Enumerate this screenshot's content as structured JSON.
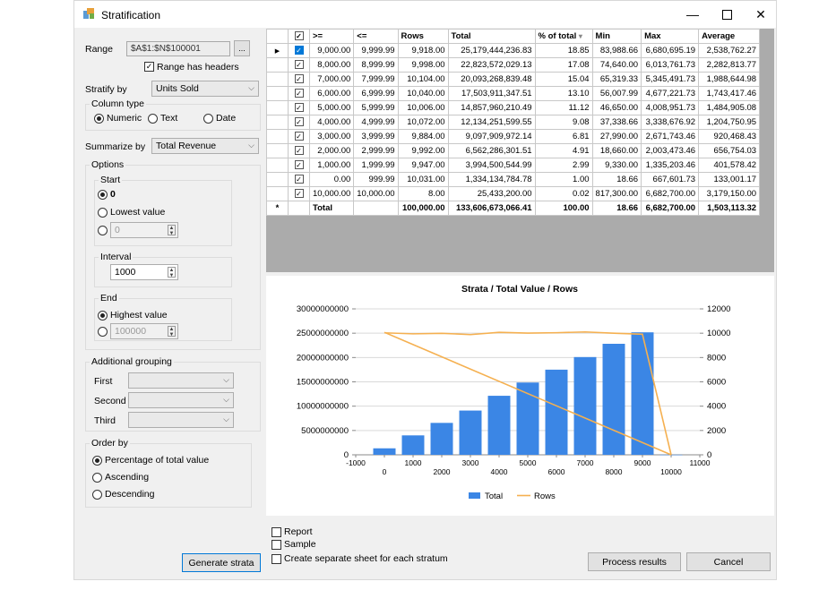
{
  "window": {
    "title": "Stratification"
  },
  "left": {
    "range_label": "Range",
    "range_value": "$A$1:$N$100001",
    "range_btn": "...",
    "has_headers_label": "Range has headers",
    "stratify_label": "Stratify by",
    "stratify_value": "Units Sold",
    "column_type_title": "Column type",
    "coltype_numeric": "Numeric",
    "coltype_text": "Text",
    "coltype_date": "Date",
    "summarize_label": "Summarize by",
    "summarize_value": "Total Revenue",
    "options_title": "Options",
    "start_title": "Start",
    "start_zero": "0",
    "start_lowest": "Lowest value",
    "start_custom": "0",
    "interval_title": "Interval",
    "interval_value": "1000",
    "end_title": "End",
    "end_highest": "Highest value",
    "end_custom": "100000",
    "addgroup_title": "Additional grouping",
    "first_label": "First",
    "second_label": "Second",
    "third_label": "Third",
    "orderby_title": "Order by",
    "order_pct": "Percentage of total value",
    "order_asc": "Ascending",
    "order_desc": "Descending",
    "generate_btn": "Generate strata"
  },
  "grid": {
    "headers": [
      ">=",
      "<=",
      "Rows",
      "Total",
      "% of total",
      "Min",
      "Max",
      "Average"
    ],
    "rows": [
      [
        "9,000.00",
        "9,999.99",
        "9,918.00",
        "25,179,444,236.83",
        "18.85",
        "83,988.66",
        "6,680,695.19",
        "2,538,762.27"
      ],
      [
        "8,000.00",
        "8,999.99",
        "9,998.00",
        "22,823,572,029.13",
        "17.08",
        "74,640.00",
        "6,013,761.73",
        "2,282,813.77"
      ],
      [
        "7,000.00",
        "7,999.99",
        "10,104.00",
        "20,093,268,839.48",
        "15.04",
        "65,319.33",
        "5,345,491.73",
        "1,988,644.98"
      ],
      [
        "6,000.00",
        "6,999.99",
        "10,040.00",
        "17,503,911,347.51",
        "13.10",
        "56,007.99",
        "4,677,221.73",
        "1,743,417.46"
      ],
      [
        "5,000.00",
        "5,999.99",
        "10,006.00",
        "14,857,960,210.49",
        "11.12",
        "46,650.00",
        "4,008,951.73",
        "1,484,905.08"
      ],
      [
        "4,000.00",
        "4,999.99",
        "10,072.00",
        "12,134,251,599.55",
        "9.08",
        "37,338.66",
        "3,338,676.92",
        "1,204,750.95"
      ],
      [
        "3,000.00",
        "3,999.99",
        "9,884.00",
        "9,097,909,972.14",
        "6.81",
        "27,990.00",
        "2,671,743.46",
        "920,468.43"
      ],
      [
        "2,000.00",
        "2,999.99",
        "9,992.00",
        "6,562,286,301.51",
        "4.91",
        "18,660.00",
        "2,003,473.46",
        "656,754.03"
      ],
      [
        "1,000.00",
        "1,999.99",
        "9,947.00",
        "3,994,500,544.99",
        "2.99",
        "9,330.00",
        "1,335,203.46",
        "401,578.42"
      ],
      [
        "0.00",
        "999.99",
        "10,031.00",
        "1,334,134,784.78",
        "1.00",
        "18.66",
        "667,601.73",
        "133,001.17"
      ],
      [
        "10,000.00",
        "10,000.00",
        "8.00",
        "25,433,200.00",
        "0.02",
        "817,300.00",
        "6,682,700.00",
        "3,179,150.00"
      ]
    ],
    "total_row": [
      "Total",
      "",
      "100,000.00",
      "133,606,673,066.41",
      "100.00",
      "18.66",
      "6,682,700.00",
      "1,503,113.32"
    ],
    "current_row_marker": "▶",
    "new_row_marker": "*"
  },
  "chart_data": {
    "type": "bar",
    "title": "Strata / Total Value / Rows",
    "x": [
      0,
      1000,
      2000,
      3000,
      4000,
      5000,
      6000,
      7000,
      8000,
      9000,
      10000
    ],
    "x_ticks": [
      -1000,
      0,
      1000,
      2000,
      3000,
      4000,
      5000,
      6000,
      7000,
      8000,
      9000,
      10000,
      11000
    ],
    "xlim": [
      -1000,
      11000
    ],
    "y_ticks": [
      0,
      5000000000,
      10000000000,
      15000000000,
      20000000000,
      25000000000,
      30000000000
    ],
    "y_tick_labels": [
      "0",
      "5000000000",
      "10000000000",
      "15000000000",
      "20000000000",
      "25000000000",
      "30000000000"
    ],
    "ylim": [
      0,
      30000000000
    ],
    "y2_ticks": [
      0,
      2000,
      4000,
      6000,
      8000,
      10000,
      12000
    ],
    "y2lim": [
      0,
      12000
    ],
    "grid": true,
    "legend": "bottom",
    "series": [
      {
        "name": "Total",
        "type": "bar",
        "axis": "left",
        "color": "#3b86e5",
        "values": [
          1334134784.78,
          3994500544.99,
          6562286301.51,
          9097909972.14,
          12134251599.55,
          14857960210.49,
          17503911347.51,
          20093268839.48,
          22823572029.13,
          25179444236.83,
          25433200.0
        ]
      },
      {
        "name": "Rows",
        "type": "line",
        "axis": "right",
        "color": "#f5b050",
        "values": [
          10031,
          9947,
          9992,
          9884,
          10072,
          10006,
          10040,
          10104,
          9998,
          9918,
          8
        ]
      }
    ],
    "extra_line": {
      "color": "#f5b050",
      "from": [
        0,
        25179444236.83
      ],
      "to": [
        10000,
        0
      ]
    }
  },
  "bottom": {
    "report_label": "Report",
    "sample_label": "Sample",
    "separate_label": "Create separate sheet for each stratum",
    "process_btn": "Process results",
    "cancel_btn": "Cancel"
  }
}
